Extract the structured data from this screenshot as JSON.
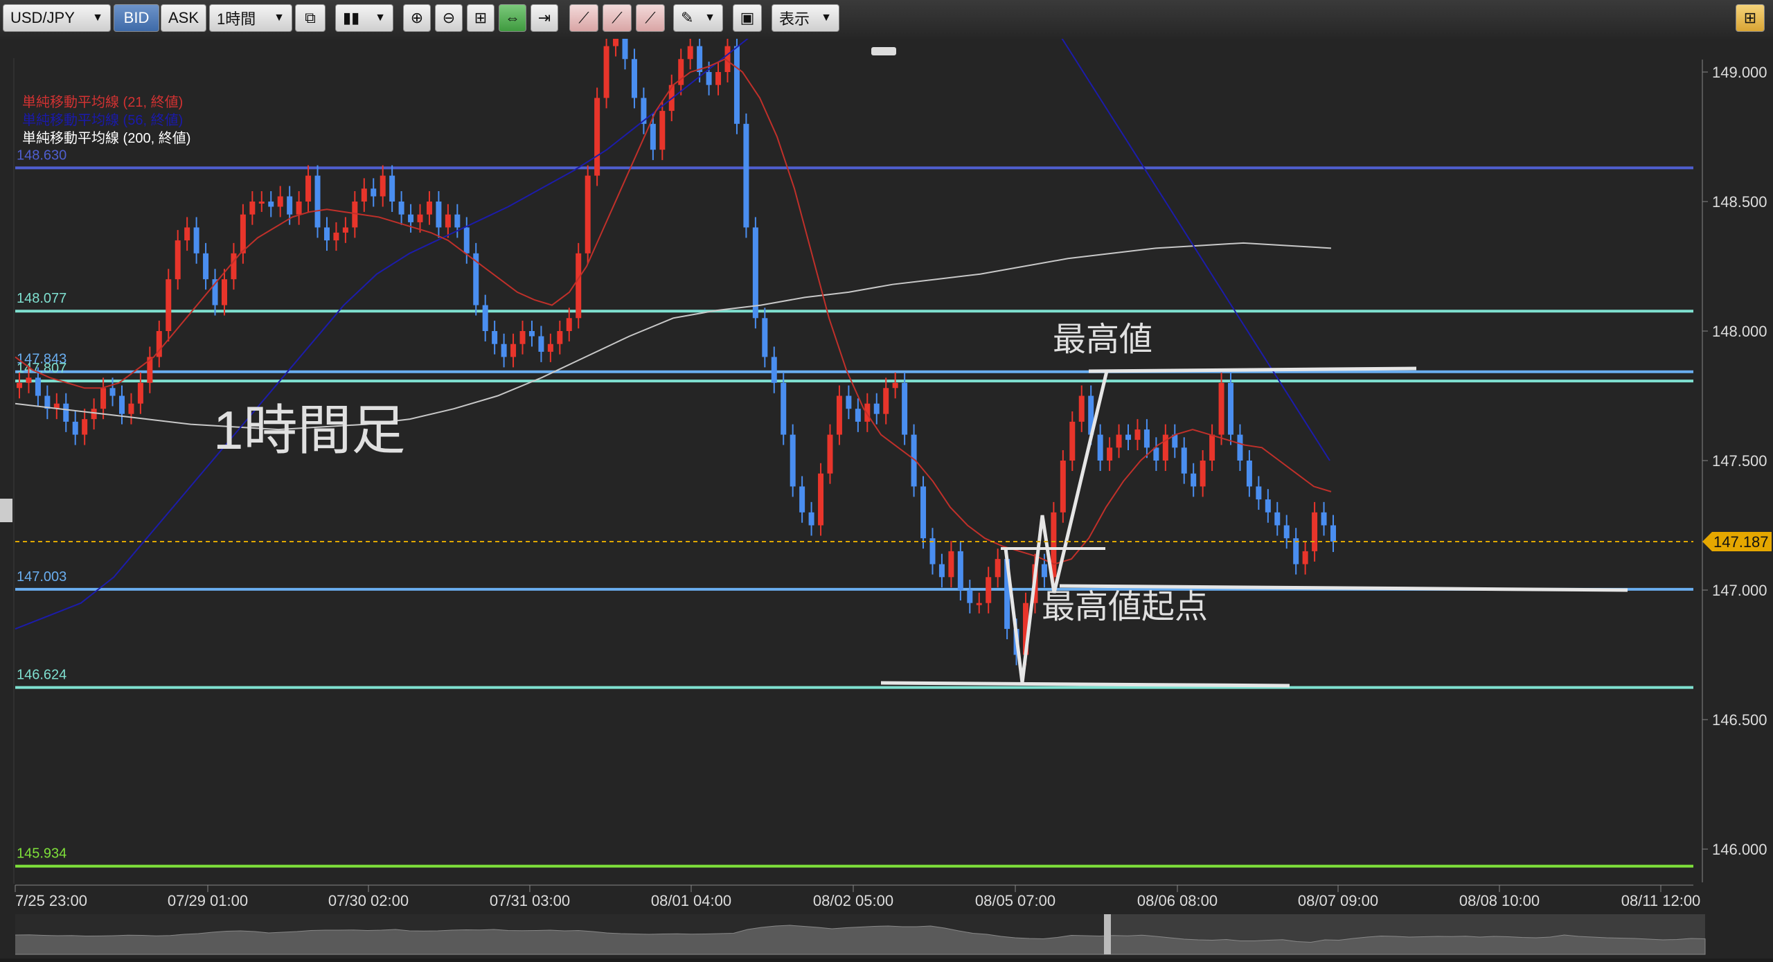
{
  "toolbar": {
    "pair": "USD/JPY",
    "bid_label": "BID",
    "ask_label": "ASK",
    "timeframe": "1時間",
    "view_label": "表示",
    "icons": [
      "compare-icon",
      "chart-type-icon",
      "zoom-in-icon",
      "zoom-out-icon",
      "fit-icon",
      "scroll-lock-icon",
      "next-icon",
      "trend-add-icon",
      "trend-edit-icon",
      "trend-delete-icon",
      "draw-pen-icon",
      "screenshot-icon",
      "settings-icon"
    ]
  },
  "legend": [
    {
      "text": "単純移動平均線 (21, 終値)",
      "color": "#d23232"
    },
    {
      "text": "単純移動平均線 (56, 終値)",
      "color": "#1a1aaa"
    },
    {
      "text": "単純移動平均線 (200, 終値)",
      "color": "#ffffff"
    }
  ],
  "annotations": {
    "timeframe_label": "1時間足",
    "high_label": "最高値",
    "high_origin_label": "最高値起点"
  },
  "colors": {
    "up": "#e8352b",
    "down": "#4a8ef0",
    "sma21": "#c0302a",
    "sma56": "#1c1caa",
    "sma200": "#c8c8c8",
    "current_price": "#e0a800"
  },
  "chart_data": {
    "type": "candlestick",
    "symbol": "USD/JPY",
    "ylim": [
      145.85,
      149.05
    ],
    "y_ticks": [
      "149.000",
      "148.500",
      "148.000",
      "147.500",
      "147.000",
      "146.500",
      "146.000"
    ],
    "x_ticks": [
      "7/25 23:00",
      "07/29 01:00",
      "07/30 02:00",
      "07/31 03:00",
      "08/01 04:00",
      "08/02 05:00",
      "08/05 07:00",
      "08/06 08:00",
      "08/07 09:00",
      "08/08 10:00",
      "08/11 12:00"
    ],
    "current_price": "147.187",
    "horizontal_lines": [
      {
        "label": "148.630",
        "value": 148.63,
        "color": "#4f5fd0"
      },
      {
        "label": "148.077",
        "value": 148.077,
        "color": "#7fe0d0"
      },
      {
        "label": "147.843",
        "value": 147.843,
        "color": "#6aaef0"
      },
      {
        "label": "147.807",
        "value": 147.807,
        "color": "#7fe0d0"
      },
      {
        "label": "147.003",
        "value": 147.003,
        "color": "#6aaef0"
      },
      {
        "label": "146.624",
        "value": 146.624,
        "color": "#7fe0d0"
      },
      {
        "label": "145.934",
        "value": 145.934,
        "color": "#7ee03a"
      }
    ],
    "candles_close": [
      147.8,
      147.82,
      147.75,
      147.7,
      147.72,
      147.65,
      147.6,
      147.66,
      147.7,
      147.78,
      147.75,
      147.68,
      147.72,
      147.8,
      147.9,
      148.0,
      148.2,
      148.35,
      148.4,
      148.3,
      148.2,
      148.1,
      148.2,
      148.3,
      148.45,
      148.5,
      148.5,
      148.48,
      148.52,
      148.45,
      148.5,
      148.6,
      148.4,
      148.35,
      148.38,
      148.4,
      148.5,
      148.55,
      148.52,
      148.6,
      148.5,
      148.45,
      148.42,
      148.45,
      148.5,
      148.4,
      148.45,
      148.4,
      148.3,
      148.1,
      148.0,
      147.95,
      147.9,
      147.95,
      148.0,
      147.98,
      147.92,
      147.95,
      148.0,
      148.05,
      148.3,
      148.6,
      148.9,
      149.1,
      149.2,
      149.05,
      148.9,
      148.8,
      148.7,
      148.85,
      148.95,
      149.05,
      149.1,
      149.0,
      148.95,
      149.0,
      149.1,
      148.8,
      148.4,
      148.05,
      147.9,
      147.8,
      147.6,
      147.4,
      147.3,
      147.25,
      147.45,
      147.6,
      147.75,
      147.7,
      147.65,
      147.72,
      147.68,
      147.78,
      147.8,
      147.6,
      147.4,
      147.2,
      147.1,
      147.05,
      147.15,
      147.0,
      146.95,
      146.95,
      147.05,
      147.12,
      146.85,
      146.75,
      146.95,
      147.1,
      147.05,
      147.3,
      147.5,
      147.65,
      147.75,
      147.6,
      147.5,
      147.55,
      147.6,
      147.58,
      147.62,
      147.55,
      147.5,
      147.6,
      147.55,
      147.45,
      147.4,
      147.5,
      147.6,
      147.8,
      147.6,
      147.5,
      147.4,
      147.35,
      147.3,
      147.25,
      147.2,
      147.1,
      147.15,
      147.3,
      147.25,
      147.187
    ],
    "candles_open": [
      147.78,
      147.8,
      147.82,
      147.75,
      147.7,
      147.72,
      147.65,
      147.6,
      147.66,
      147.7,
      147.78,
      147.75,
      147.68,
      147.72,
      147.8,
      147.9,
      148.0,
      148.2,
      148.35,
      148.4,
      148.3,
      148.2,
      148.1,
      148.2,
      148.3,
      148.45,
      148.5,
      148.5,
      148.48,
      148.52,
      148.45,
      148.5,
      148.6,
      148.4,
      148.35,
      148.38,
      148.4,
      148.5,
      148.55,
      148.52,
      148.6,
      148.5,
      148.45,
      148.42,
      148.45,
      148.5,
      148.4,
      148.45,
      148.4,
      148.3,
      148.1,
      148.0,
      147.95,
      147.9,
      147.95,
      148.0,
      147.98,
      147.92,
      147.95,
      148.0,
      148.05,
      148.3,
      148.6,
      148.9,
      149.1,
      149.2,
      149.05,
      148.9,
      148.8,
      148.7,
      148.85,
      148.95,
      149.05,
      149.1,
      149.0,
      148.95,
      149.0,
      149.1,
      148.8,
      148.4,
      148.05,
      147.9,
      147.8,
      147.6,
      147.4,
      147.3,
      147.25,
      147.45,
      147.6,
      147.75,
      147.7,
      147.65,
      147.72,
      147.68,
      147.78,
      147.8,
      147.6,
      147.4,
      147.2,
      147.1,
      147.05,
      147.15,
      147.0,
      146.95,
      146.95,
      147.05,
      147.12,
      146.85,
      146.75,
      146.95,
      147.1,
      147.05,
      147.3,
      147.5,
      147.65,
      147.75,
      147.6,
      147.5,
      147.55,
      147.6,
      147.58,
      147.62,
      147.55,
      147.5,
      147.6,
      147.55,
      147.45,
      147.4,
      147.5,
      147.6,
      147.8,
      147.6,
      147.5,
      147.4,
      147.35,
      147.3,
      147.25,
      147.2,
      147.1,
      147.15,
      147.3,
      147.25
    ],
    "sma21": [
      147.9,
      147.85,
      147.82,
      147.8,
      147.78,
      147.78,
      147.8,
      147.85,
      147.9,
      147.98,
      148.06,
      148.14,
      148.22,
      148.3,
      148.36,
      148.4,
      148.44,
      148.46,
      148.47,
      148.46,
      148.45,
      148.44,
      148.42,
      148.4,
      148.38,
      148.35,
      148.3,
      148.25,
      148.2,
      148.15,
      148.12,
      148.1,
      148.15,
      148.25,
      148.4,
      148.55,
      148.7,
      148.85,
      148.95,
      149.0,
      149.02,
      149.05,
      149.0,
      148.9,
      148.75,
      148.55,
      148.3,
      148.05,
      147.85,
      147.7,
      147.6,
      147.55,
      147.5,
      147.42,
      147.32,
      147.25,
      147.2,
      147.17,
      147.15,
      147.13,
      147.1,
      147.12,
      147.2,
      147.32,
      147.42,
      147.5,
      147.56,
      147.6,
      147.62,
      147.6,
      147.58,
      147.56,
      147.55,
      147.5,
      147.45,
      147.4,
      147.38
    ],
    "sma56": [
      146.85,
      146.9,
      146.95,
      147.05,
      147.2,
      147.35,
      147.5,
      147.65,
      147.8,
      147.95,
      148.1,
      148.22,
      148.3,
      148.36,
      148.42,
      148.48,
      148.55,
      148.62,
      148.7,
      148.8,
      148.9,
      149.0,
      149.1,
      149.2,
      149.3,
      149.4,
      149.5,
      149.55,
      149.6,
      149.55,
      149.45,
      149.3,
      149.1,
      148.9,
      148.7,
      148.5,
      148.3,
      148.1,
      147.9,
      147.7,
      147.5
    ],
    "sma200": [
      147.72,
      147.7,
      147.68,
      147.66,
      147.64,
      147.63,
      147.62,
      147.63,
      147.64,
      147.66,
      147.7,
      147.75,
      147.82,
      147.9,
      147.98,
      148.05,
      148.08,
      148.1,
      148.13,
      148.15,
      148.18,
      148.2,
      148.22,
      148.25,
      148.28,
      148.3,
      148.32,
      148.33,
      148.34,
      148.33,
      148.32
    ]
  }
}
